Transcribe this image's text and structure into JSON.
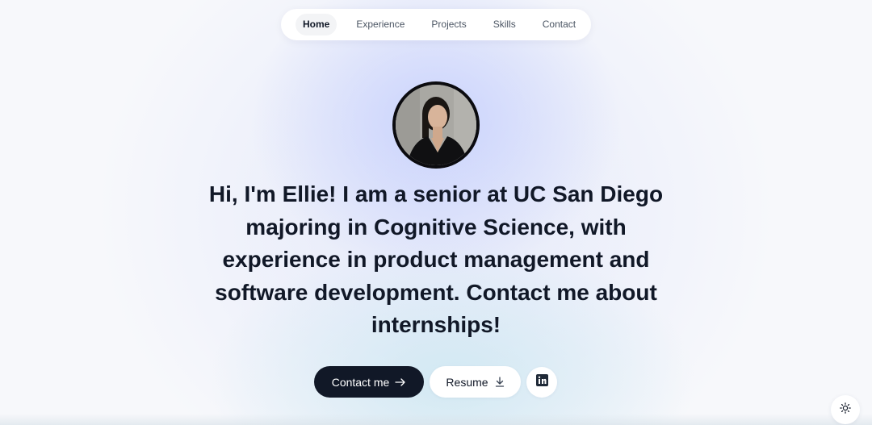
{
  "nav": {
    "items": [
      {
        "label": "Home",
        "active": true
      },
      {
        "label": "Experience",
        "active": false
      },
      {
        "label": "Projects",
        "active": false
      },
      {
        "label": "Skills",
        "active": false
      },
      {
        "label": "Contact",
        "active": false
      }
    ]
  },
  "hero": {
    "avatar_icon": "profile-photo",
    "headline": "Hi, I'm Ellie! I am a senior at UC San Diego majoring in Cognitive Science, with experience in product management and software development. Contact me about internships!"
  },
  "actions": {
    "contact_label": "Contact me",
    "contact_icon": "arrow-right-icon",
    "resume_label": "Resume",
    "resume_icon": "download-icon",
    "linkedin_icon": "linkedin-icon"
  },
  "theme_toggle": {
    "icon": "sun-icon"
  },
  "colors": {
    "primary_button": "#111827",
    "accent_glow": "#c4cefc"
  }
}
